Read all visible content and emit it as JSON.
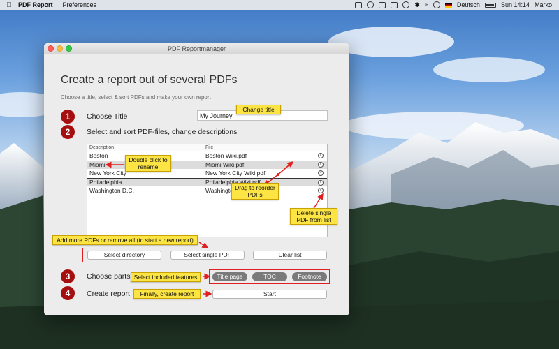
{
  "menubar": {
    "app_name": "PDF Report",
    "menus": [
      "Preferences"
    ],
    "language": "Deutsch",
    "clock": "Sun 14:14",
    "user": "Marko"
  },
  "window": {
    "title": "PDF Reportmanager",
    "heading": "Create a report out of several PDFs",
    "subheading": "Choose a title, select & sort PDFs and make your own report"
  },
  "steps": [
    {
      "number": "1",
      "label": "Choose Title"
    },
    {
      "number": "2",
      "label": "Select and sort PDF-files, change descriptions"
    },
    {
      "number": "3",
      "label": "Choose parts"
    },
    {
      "number": "4",
      "label": "Create report"
    }
  ],
  "title_input": {
    "value": "My Journey"
  },
  "table": {
    "headers": {
      "description": "Description",
      "file": "File"
    },
    "rows": [
      {
        "description": "Boston",
        "file": "Boston Wiki.pdf"
      },
      {
        "description": "Miami",
        "file": "Miami Wiki.pdf"
      },
      {
        "description": "New York City",
        "file": "New York City Wiki.pdf"
      },
      {
        "description": "Philadelphia",
        "file": "Philadelphia Wiki.pdf"
      },
      {
        "description": "Washington D.C.",
        "file": "Washington"
      }
    ]
  },
  "buttons": {
    "select_directory": "Select directory",
    "select_single_pdf": "Select single PDF",
    "clear_list": "Clear list",
    "start": "Start"
  },
  "parts": [
    "Title page",
    "TOC",
    "Footnote"
  ],
  "callouts": {
    "change_title": "Change title",
    "double_click": "Double click to rename",
    "drag": "Drag to reorder PDFs",
    "delete": "Delete single PDF from list",
    "add_more": "Add more PDFs or remove all (to start a new report)",
    "features": "Select included features",
    "create": "Finally, create report"
  },
  "colors": {
    "step_badge": "#a50f0f",
    "callout": "#fbe443",
    "highlight": "#e02020"
  }
}
